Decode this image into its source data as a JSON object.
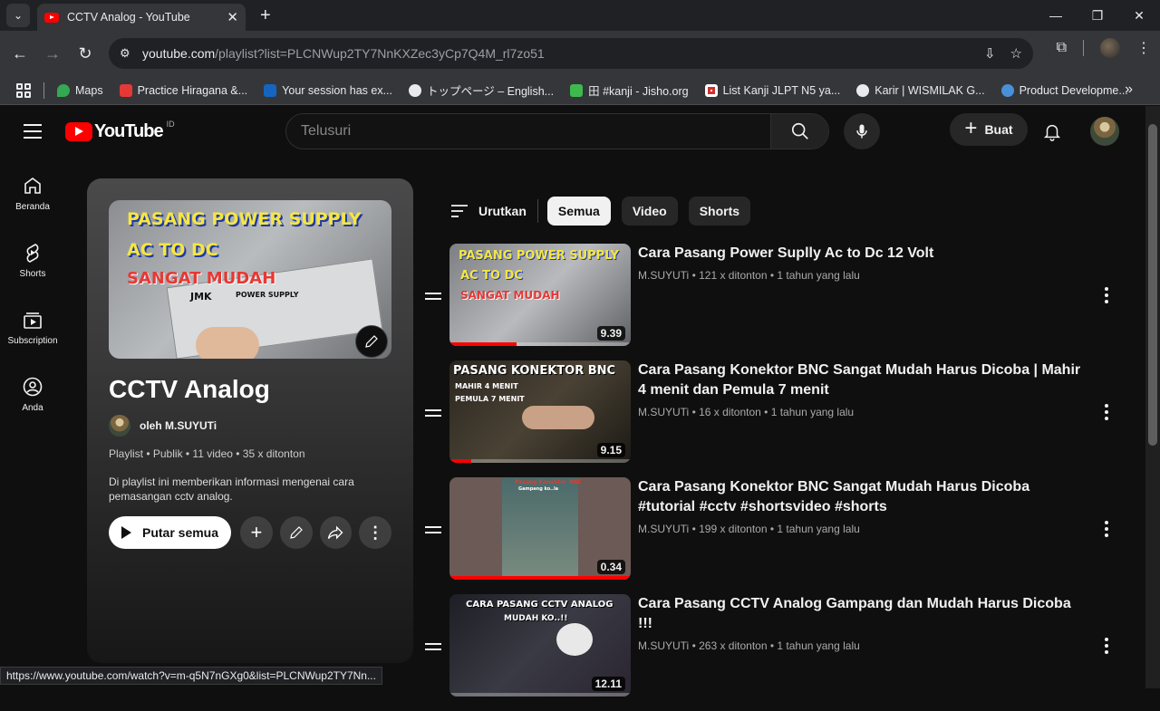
{
  "browser": {
    "tab_title": "CCTV Analog - YouTube",
    "url_host": "youtube.com",
    "url_path": "/playlist?list=PLCNWup2TY7NnKXZec3yCp7Q4M_rl7zo51",
    "status_url": "https://www.youtube.com/watch?v=m-q5N7nGXg0&list=PLCNWup2TY7Nn..."
  },
  "bookmarks": [
    "Maps",
    "Practice Hiragana &...",
    "Your session has ex...",
    "トップページ – English...",
    "田 #kanji - Jisho.org",
    "List Kanji JLPT N5 ya...",
    "Karir | WISMILAK G...",
    "Product Developme..."
  ],
  "yt": {
    "logo": "YouTube",
    "country": "ID",
    "search_placeholder": "Telusuri",
    "create_label": "Buat"
  },
  "guide": [
    {
      "label": "Beranda",
      "icon": "home-icon"
    },
    {
      "label": "Shorts",
      "icon": "shorts-icon"
    },
    {
      "label": "Subscription",
      "icon": "subscriptions-icon"
    },
    {
      "label": "Anda",
      "icon": "you-icon"
    }
  ],
  "playlist": {
    "title": "CCTV Analog",
    "owner": "oleh M.SUYUTi",
    "meta": "Playlist • Publik • 11 video • 35 x ditonton",
    "description": "Di playlist ini memberikan informasi mengenai cara pemasangan cctv analog.",
    "play_all": "Putar semua",
    "thumb_lines": [
      "PASANG POWER SUPPLY",
      "AC TO DC",
      "SANGAT MUDAH",
      "JMK",
      "POWER SUPPLY"
    ]
  },
  "filters": {
    "sort_label": "Urutkan",
    "chips": [
      "Semua",
      "Video",
      "Shorts"
    ],
    "active": "Semua"
  },
  "videos": [
    {
      "title": "Cara Pasang Power Suplly Ac to Dc 12 Volt",
      "channel": "M.SUYUTi",
      "views": "121 x ditonton",
      "age": "1 tahun yang lalu",
      "duration": "9.39",
      "progress": 0.37,
      "thumb_text": [
        "PASANG POWER SUPPLY",
        "AC TO DC",
        "SANGAT MUDAH"
      ]
    },
    {
      "title": "Cara Pasang Konektor BNC Sangat Mudah Harus Dicoba | Mahir 4 menit dan Pemula 7 menit",
      "channel": "M.SUYUTi",
      "views": "16 x ditonton",
      "age": "1 tahun yang lalu",
      "duration": "9.15",
      "progress": 0.12,
      "thumb_text": [
        "PASANG KONEKTOR BNC",
        "MAHIR 4 MENIT",
        "PEMULA 7 MENIT"
      ]
    },
    {
      "title": "Cara Pasang Konektor BNC Sangat Mudah Harus Dicoba #tutorial #cctv #shortsvideo #shorts",
      "channel": "M.SUYUTi",
      "views": "199 x ditonton",
      "age": "1 tahun yang lalu",
      "duration": "0.34",
      "progress": 1.0,
      "thumb_text": [
        "Pasang Konektor BNC",
        "Gampang ko..la"
      ]
    },
    {
      "title": "Cara Pasang CCTV Analog Gampang dan Mudah Harus Dicoba !!!",
      "channel": "M.SUYUTi",
      "views": "263 x ditonton",
      "age": "1 tahun yang lalu",
      "duration": "12.11",
      "progress": 0.0,
      "thumb_text": [
        "CARA PASANG CCTV ANALOG",
        "MUDAH KO..!!"
      ]
    }
  ]
}
